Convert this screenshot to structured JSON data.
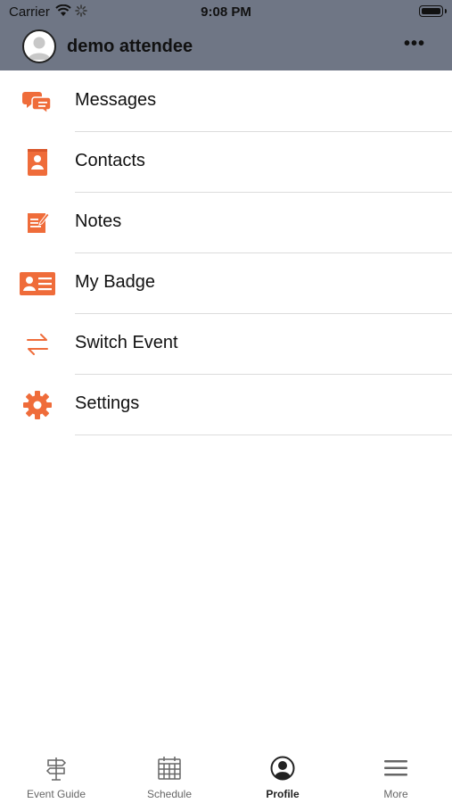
{
  "status_bar": {
    "carrier": "Carrier",
    "time": "9:08 PM"
  },
  "header": {
    "username": "demo attendee",
    "more_label": "•••"
  },
  "menu": [
    {
      "label": "Messages",
      "icon": "chat-bubbles-icon"
    },
    {
      "label": "Contacts",
      "icon": "address-book-icon"
    },
    {
      "label": "Notes",
      "icon": "note-pencil-icon"
    },
    {
      "label": "My Badge",
      "icon": "id-badge-icon"
    },
    {
      "label": "Switch Event",
      "icon": "switch-arrows-icon"
    },
    {
      "label": "Settings",
      "icon": "gear-icon"
    }
  ],
  "tabbar": {
    "tabs": [
      {
        "label": "Event Guide",
        "icon": "signpost-icon"
      },
      {
        "label": "Schedule",
        "icon": "calendar-icon"
      },
      {
        "label": "Profile",
        "icon": "profile-icon",
        "active": true
      },
      {
        "label": "More",
        "icon": "hamburger-icon"
      }
    ]
  },
  "colors": {
    "accent": "#ef6c3a",
    "header_bg": "#6f7685"
  }
}
